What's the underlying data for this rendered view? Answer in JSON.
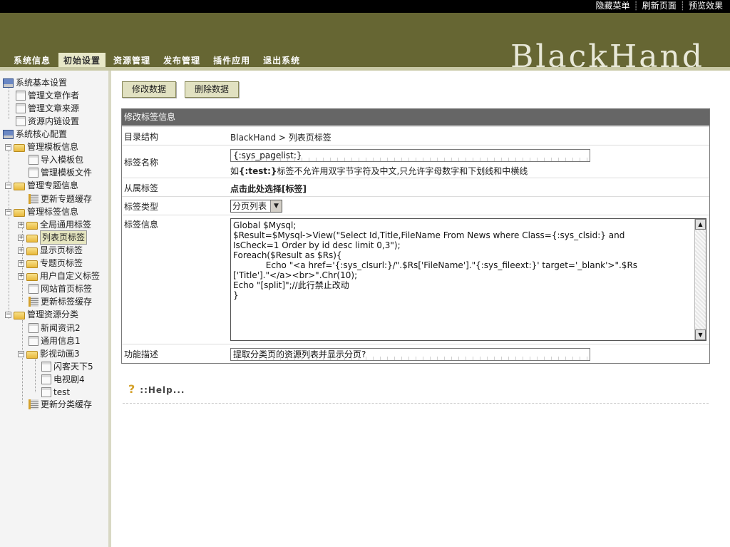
{
  "topbar": {
    "links": [
      "隐藏菜单",
      "刷新页面",
      "预览效果"
    ]
  },
  "header": {
    "logo": "BlackHand",
    "tabs": [
      "系统信息",
      "初始设置",
      "资源管理",
      "发布管理",
      "插件应用",
      "退出系统"
    ],
    "active_tab": "初始设置"
  },
  "sidebar": {
    "items": [
      {
        "label": "系统基本设置",
        "icon": "computer-icon"
      },
      {
        "label": "管理文章作者",
        "icon": "page-icon"
      },
      {
        "label": "管理文章来源",
        "icon": "page-icon"
      },
      {
        "label": "资源内链设置",
        "icon": "page-icon"
      },
      {
        "label": "系统核心配置",
        "icon": "computer-icon"
      },
      {
        "label": "管理模板信息",
        "icon": "folder-open-icon"
      },
      {
        "label": "导入模板包",
        "icon": "page-icon"
      },
      {
        "label": "管理模板文件",
        "icon": "page-icon"
      },
      {
        "label": "管理专题信息",
        "icon": "folder-open-icon"
      },
      {
        "label": "更新专题缓存",
        "icon": "cache-icon"
      },
      {
        "label": "管理标签信息",
        "icon": "folder-open-icon"
      },
      {
        "label": "全局通用标签",
        "icon": "folder-icon"
      },
      {
        "label": "列表页标签",
        "icon": "folder-icon",
        "selected": true
      },
      {
        "label": "显示页标签",
        "icon": "folder-icon"
      },
      {
        "label": "专题页标签",
        "icon": "folder-icon"
      },
      {
        "label": "用户自定义标签",
        "icon": "folder-icon"
      },
      {
        "label": "网站首页标签",
        "icon": "page-icon"
      },
      {
        "label": "更新标签缓存",
        "icon": "cache-icon"
      },
      {
        "label": "管理资源分类",
        "icon": "folder-open-icon"
      },
      {
        "label": "新闻资讯2",
        "icon": "page-icon"
      },
      {
        "label": "通用信息1",
        "icon": "page-icon"
      },
      {
        "label": "影视动画3",
        "icon": "folder-open-icon"
      },
      {
        "label": "闪客天下5",
        "icon": "page-icon"
      },
      {
        "label": "电视剧4",
        "icon": "page-icon"
      },
      {
        "label": "test",
        "icon": "page-icon"
      },
      {
        "label": "更新分类缓存",
        "icon": "cache-icon"
      }
    ]
  },
  "toolbar": {
    "modify_label": "修改数据",
    "delete_label": "删除数据"
  },
  "form": {
    "title": "修改标签信息",
    "dir_label": "目录结构",
    "dir_value": "BlackHand > 列表页标签",
    "name_label": "标签名称",
    "name_value": "{:sys_pagelist:}",
    "name_hint_prefix": "如",
    "name_hint_example": "{:test:}",
    "name_hint_suffix": "标签不允许用双字节字符及中文,只允许字母数字和下划线和中横线",
    "parent_label": "从属标签",
    "parent_value": "点击此处选择[标签]",
    "type_label": "标签类型",
    "type_value": "分页列表",
    "info_label": "标签信息",
    "info_value": "Global $Mysql;\n$Result=$Mysql->View(\"Select Id,Title,FileName From News where Class={:sys_clsid:} and\nIsCheck=1 Order by id desc limit 0,3\");\nForeach($Result as $Rs){\n            Echo \"<a href='{:sys_clsurl:}/\".$Rs['FileName'].\"{:sys_fileext:}' target='_blank'>\".$Rs\n['Title'].\"</a><br>\".Chr(10);\nEcho \"[split]\";//此行禁止改动\n}",
    "desc_label": "功能描述",
    "desc_value": "提取分类页的资源列表并显示分页?"
  },
  "help": {
    "label": "::Help..."
  }
}
